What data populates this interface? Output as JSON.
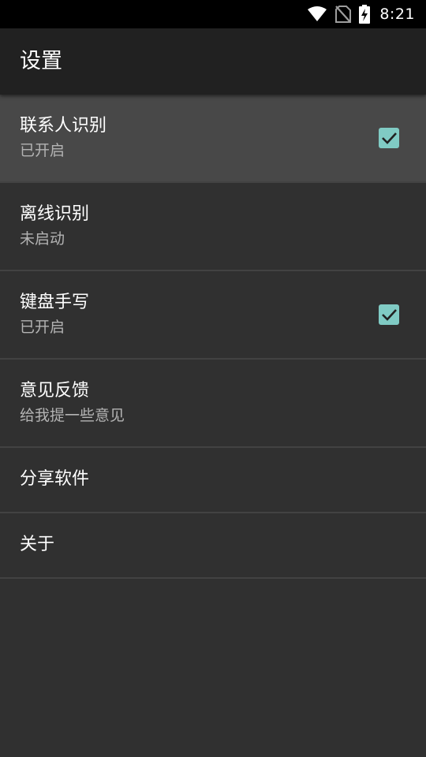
{
  "status_bar": {
    "time": "8:21",
    "icons": [
      "wifi-icon",
      "no-sim-icon",
      "battery-charging-icon"
    ]
  },
  "app_bar": {
    "title": "设置"
  },
  "settings": {
    "items": [
      {
        "title": "联系人识别",
        "summary": "已开启",
        "checked": true
      },
      {
        "title": "离线识别",
        "summary": "未启动",
        "checked": false
      },
      {
        "title": "键盘手写",
        "summary": "已开启",
        "checked": true
      },
      {
        "title": "意见反馈",
        "summary": "给我提一些意见"
      },
      {
        "title": "分享软件"
      },
      {
        "title": "关于"
      }
    ]
  },
  "colors": {
    "background": "#303030",
    "app_bar": "#212121",
    "status_bar": "#000000",
    "highlight": "#484848",
    "checkbox_accent": "#80cbc4",
    "divider": "#424242",
    "summary_text": "#b3b3b3"
  }
}
